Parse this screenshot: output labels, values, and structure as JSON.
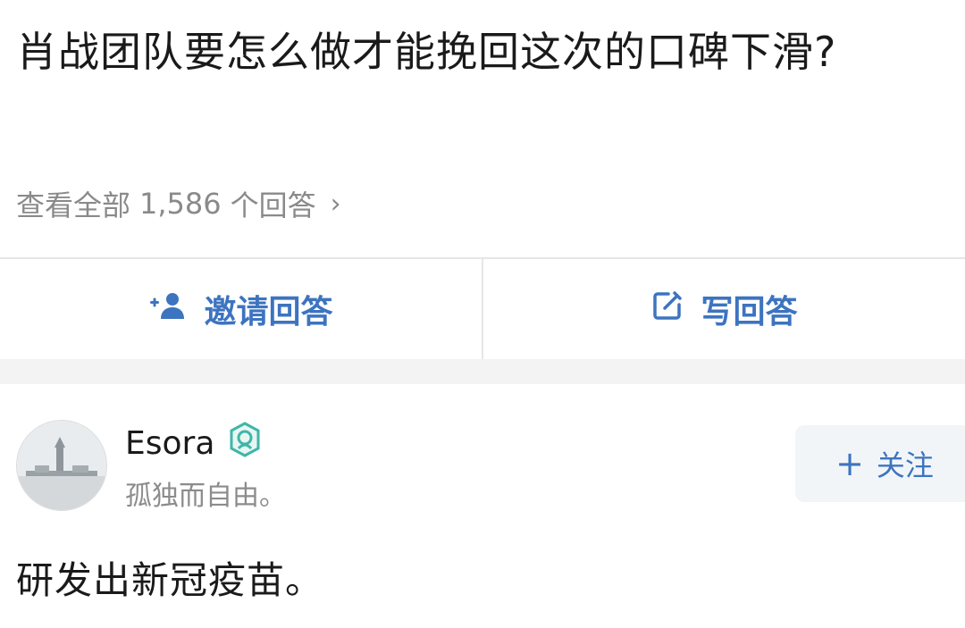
{
  "question": {
    "title": "肖战团队要怎么做才能挽回这次的口碑下滑?",
    "view_all_prefix": "查看全部",
    "answer_count": "1,586",
    "view_all_suffix": "个回答"
  },
  "actions": {
    "invite_label": "邀请回答",
    "write_label": "写回答"
  },
  "answer": {
    "author_name": "Esora",
    "author_bio": "孤独而自由。",
    "follow_label": "关注",
    "content": "研发出新冠疫苗。"
  },
  "icons": {
    "invite": "add-person-icon",
    "write": "edit-icon",
    "badge": "verified-badge-icon",
    "follow": "plus-icon",
    "chevron": "chevron-right-icon"
  },
  "colors": {
    "accent": "#3d74c0",
    "secondary_text": "#8a8a8a",
    "badge": "#3fb6a8"
  }
}
